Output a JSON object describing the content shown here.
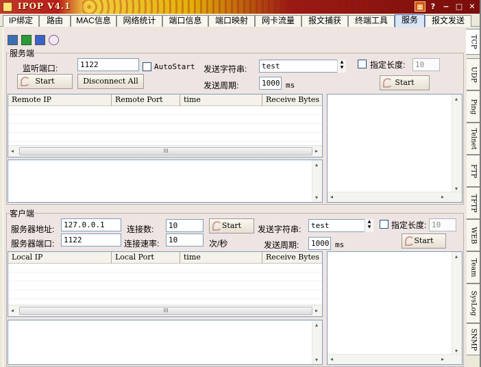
{
  "app": {
    "title": "IPOP V4.1"
  },
  "titlebar": {
    "help": "?",
    "minimize": "−",
    "maximize": "□",
    "close": "✕"
  },
  "tabs": [
    {
      "label": "IP绑定"
    },
    {
      "label": "路由"
    },
    {
      "label": "MAC信息"
    },
    {
      "label": "网络统计"
    },
    {
      "label": "端口信息"
    },
    {
      "label": "端口映射"
    },
    {
      "label": "网卡流量"
    },
    {
      "label": "报文捕获"
    },
    {
      "label": "终端工具"
    },
    {
      "label": "服务",
      "active": true
    },
    {
      "label": "报文发送"
    }
  ],
  "side_tabs": [
    {
      "label": "TCP",
      "active": true
    },
    {
      "label": "UDP"
    },
    {
      "label": "Ping"
    },
    {
      "label": "Telnet"
    },
    {
      "label": "FTP"
    },
    {
      "label": "TFTP"
    },
    {
      "label": "WEB"
    },
    {
      "label": "Team"
    },
    {
      "label": "SysLog"
    },
    {
      "label": "SNMP"
    }
  ],
  "toolbar_icons": [
    "monitor-icon",
    "network-card-icon",
    "computer-arrow-icon",
    "magnifier-icon"
  ],
  "server": {
    "group_title": "服务端",
    "listen_port_label": "监听端口:",
    "listen_port": "1122",
    "autostart_label": "AutoStart",
    "autostart_checked": false,
    "send_string_label": "发送字符串:",
    "send_string": "test",
    "fixed_length_label": "指定长度:",
    "fixed_length_checked": false,
    "fixed_length": "10",
    "send_period_label": "发送周期:",
    "send_period": "1000",
    "send_period_unit": "ms",
    "start_button": "Start",
    "disconnect_button": "Disconnect All",
    "send_start_button": "Start",
    "columns": [
      "Remote IP",
      "Remote Port",
      "time",
      "Receive Bytes"
    ]
  },
  "client": {
    "group_title": "客户端",
    "server_address_label": "服务器地址:",
    "server_address": "127.0.0.1",
    "server_port_label": "服务器端口:",
    "server_port": "1122",
    "connections_label": "连接数:",
    "connections": "10",
    "rate_label": "连接速率:",
    "rate": "10",
    "rate_unit": "次/秒",
    "connect_start_button": "Start",
    "send_string_label": "发送字符串:",
    "send_string": "test",
    "fixed_length_label": "指定长度:",
    "fixed_length_checked": false,
    "fixed_length": "10",
    "send_period_label": "发送周期:",
    "send_period": "1000",
    "send_period_unit": "ms",
    "send_start_button": "Start",
    "columns": [
      "Local IP",
      "Local Port",
      "time",
      "Receive Bytes"
    ]
  },
  "scrollbar": {
    "thumb_grip": "III",
    "left": "◂",
    "right": "▸",
    "up": "▴",
    "down": "▾"
  },
  "colors": {
    "panel_bg": "#eee4e2",
    "active_tab": "#d9e6f7",
    "titlebar_red": "#b71c1c",
    "titlebar_gold": "#e2b007"
  }
}
